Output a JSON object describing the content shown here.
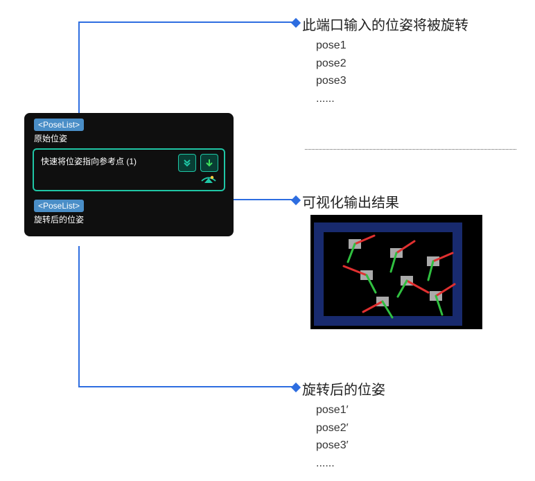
{
  "callouts": {
    "input": {
      "title": "此端口输入的位姿将被旋转",
      "items": [
        "pose1",
        "pose2",
        "pose3",
        "......"
      ]
    },
    "viz": {
      "title": "可视化输出结果"
    },
    "output": {
      "title": "旋转后的位姿",
      "items": [
        "pose1′",
        "pose2′",
        "pose3′",
        "......"
      ]
    }
  },
  "node": {
    "port_type": "<PoseList>",
    "input_port_label": "原始位姿",
    "step_title": "快速将位姿指向参考点 (1)",
    "output_port_label": "旋转后的位姿",
    "icons": {
      "dropdown": "dropdown-icon",
      "run": "run-icon",
      "eye": "eye-icon"
    }
  },
  "colors": {
    "accent": "#2d6de0",
    "node_border": "#1fc7a6",
    "port_bg": "#4a8ec7"
  }
}
